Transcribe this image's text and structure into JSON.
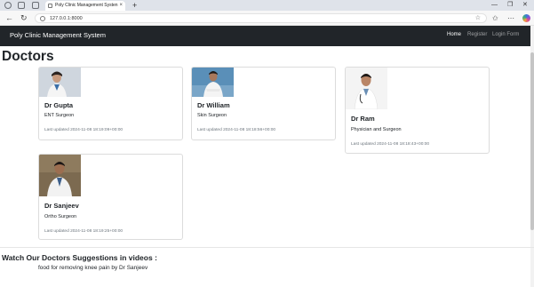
{
  "browser": {
    "tab_title": "Poly Clinic Management Systen",
    "url": "127.0.0.1:8000"
  },
  "navbar": {
    "brand": "Poly Clinic Management System",
    "links": [
      "Home",
      "Register",
      "Login Form"
    ]
  },
  "page": {
    "title": "Doctors"
  },
  "doctors": [
    {
      "name": "Dr Gupta",
      "role": "ENT Surgeon",
      "updated": "Last updated 2024-11-08 18:19:09+00:00"
    },
    {
      "name": "Dr William",
      "role": "Skin Surgeon",
      "updated": "Last updated 2024-11-08 18:18:56+00:00"
    },
    {
      "name": "Dr Ram",
      "role": "Physician and Surgeon",
      "updated": "Last updated 2024-11-08 18:18:43+00:00"
    },
    {
      "name": "Dr Sanjeev",
      "role": "Ortho Surgeon",
      "updated": "Last updated 2024-11-08 18:19:25+00:00"
    }
  ],
  "videos": {
    "heading": "Watch Our Doctors Suggestions in videos :",
    "items": [
      "food for removing knee pain by Dr Sanjeev"
    ]
  }
}
